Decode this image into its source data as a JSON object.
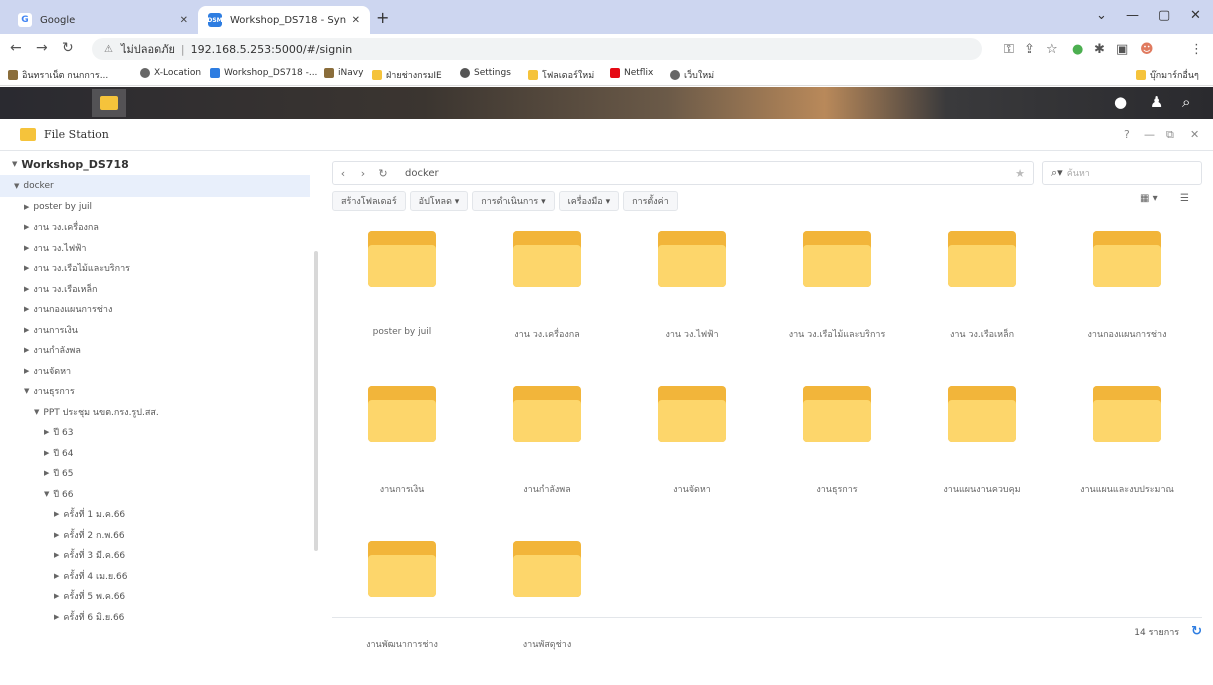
{
  "browser": {
    "tabs": [
      {
        "title": "Google",
        "icon": "G",
        "active": false
      },
      {
        "title": "Workshop_DS718 - Synology DS...",
        "icon": "DSM",
        "active": true
      }
    ],
    "url_status": "ไม่ปลอดภัย",
    "url": "192.168.5.253:5000/#/signin",
    "bookmarks": [
      "อินทราเน็ต กนกการ...",
      "X-Location",
      "Workshop_DS718 -...",
      "iNavy",
      "ฝ่ายช่างกรมIE",
      "Settings",
      "โฟลเดอร์ใหม่",
      "Netflix",
      "เว็บใหม่"
    ],
    "bookmarks_other": "บุ๊กมาร์กอื่นๆ"
  },
  "colors": {
    "folder_back": "#f2b53a",
    "folder_front": "#fdd66b",
    "accent": "#2e7de1",
    "selection": "#e8effb"
  },
  "window": {
    "title": "File Station",
    "controls": [
      "?",
      "—",
      "⧉",
      "✕"
    ]
  },
  "sidebar": {
    "root": "Workshop_DS718",
    "items": [
      {
        "label": "docker",
        "arrow": "▼",
        "indent": 1,
        "selected": true
      },
      {
        "label": "poster by juil",
        "arrow": "▶",
        "indent": 2
      },
      {
        "label": "งาน วง.เครื่องกล",
        "arrow": "▶",
        "indent": 2
      },
      {
        "label": "งาน วง.ไฟฟ้า",
        "arrow": "▶",
        "indent": 2
      },
      {
        "label": "งาน วง.เรือไม้และบริการ",
        "arrow": "▶",
        "indent": 2
      },
      {
        "label": "งาน วง.เรือเหล็ก",
        "arrow": "▶",
        "indent": 2
      },
      {
        "label": "งานกองแผนการช่าง",
        "arrow": "▶",
        "indent": 2
      },
      {
        "label": "งานการเงิน",
        "arrow": "▶",
        "indent": 2
      },
      {
        "label": "งานกำลังพล",
        "arrow": "▶",
        "indent": 2
      },
      {
        "label": "งานจัดหา",
        "arrow": "▶",
        "indent": 2
      },
      {
        "label": "งานธุรการ",
        "arrow": "▼",
        "indent": 2
      },
      {
        "label": "PPT ประชุม นขต.กรง.รูป.สส.",
        "arrow": "▼",
        "indent": 3
      },
      {
        "label": "ปี 63",
        "arrow": "▶",
        "indent": 4
      },
      {
        "label": "ปี 64",
        "arrow": "▶",
        "indent": 4
      },
      {
        "label": "ปี 65",
        "arrow": "▶",
        "indent": 4
      },
      {
        "label": "ปี 66",
        "arrow": "▼",
        "indent": 4
      },
      {
        "label": "ครั้งที่ 1 ม.ค.66",
        "arrow": "▶",
        "indent": 5
      },
      {
        "label": "ครั้งที่ 2 ก.พ.66",
        "arrow": "▶",
        "indent": 5
      },
      {
        "label": "ครั้งที่ 3 มี.ค.66",
        "arrow": "▶",
        "indent": 5
      },
      {
        "label": "ครั้งที่ 4 เม.ย.66",
        "arrow": "▶",
        "indent": 5
      },
      {
        "label": "ครั้งที่ 5 พ.ค.66",
        "arrow": "▶",
        "indent": 5
      },
      {
        "label": "ครั้งที่ 6 มิ.ย.66",
        "arrow": "▶",
        "indent": 5
      }
    ]
  },
  "main": {
    "path": "docker",
    "search_placeholder": "ค้นหา",
    "toolbar": [
      "สร้างโฟลเดอร์",
      "อัปโหลด ▾",
      "การดำเนินการ ▾",
      "เครื่องมือ ▾",
      "การตั้งค่า"
    ],
    "folders": [
      "poster by juil",
      "งาน วง.เครื่องกล",
      "งาน วง.ไฟฟ้า",
      "งาน วง.เรือไม้และบริการ",
      "งาน วง.เรือเหล็ก",
      "งานกองแผนการช่าง",
      "งานการเงิน",
      "งานกำลังพล",
      "งานจัดหา",
      "งานธุรการ",
      "งานแผนงานควบคุม",
      "งานแผนและงบประมาณ",
      "งานพัฒนาการช่าง",
      "งานพัสดุช่าง"
    ],
    "status": "14 รายการ"
  }
}
